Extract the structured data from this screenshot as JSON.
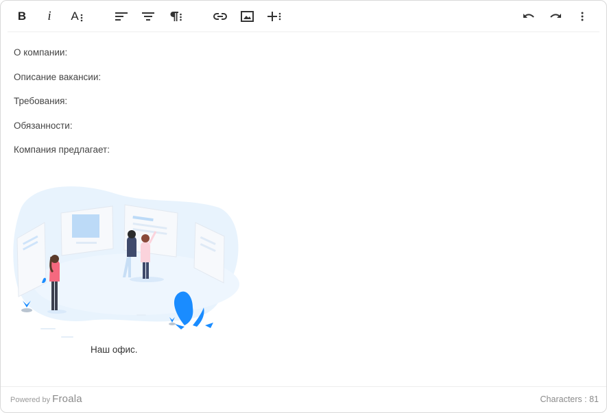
{
  "toolbar": {
    "bold_label": "B",
    "italic_label": "i",
    "font_size_label": "A",
    "buttons_left": [
      "bold",
      "italic",
      "font-size",
      "align-left",
      "align-center",
      "paragraph-format",
      "insert-link",
      "insert-image",
      "more-insert"
    ],
    "buttons_right": [
      "undo",
      "redo",
      "more-options"
    ]
  },
  "content": {
    "paragraphs": [
      "О компании:",
      "Описание вакансии:",
      "Требования:",
      "Обязанности:",
      "Компания предлагает:"
    ],
    "image_caption": "Наш офис."
  },
  "footer": {
    "powered_by": "Powered by",
    "brand": "Froala",
    "characters_label": "Characters : 81"
  },
  "colors": {
    "accent_blue": "#1a8cff",
    "blob": "#e8f3fd",
    "panel": "#f4f8fd",
    "pink": "#f5697f"
  }
}
